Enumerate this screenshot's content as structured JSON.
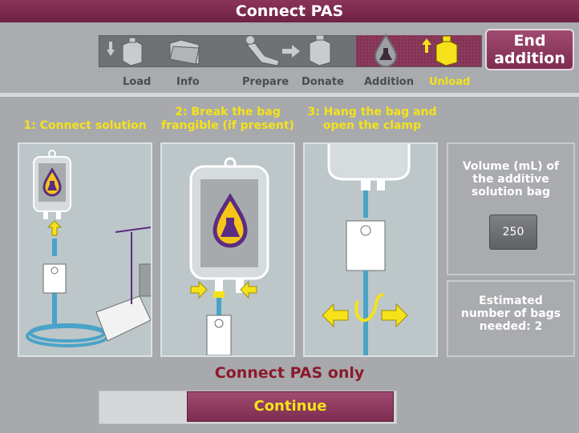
{
  "title": "Connect PAS",
  "steps": [
    {
      "label": "Load",
      "active": false
    },
    {
      "label": "Info",
      "active": false
    },
    {
      "label": "Prepare",
      "active": false
    },
    {
      "label": "Donate",
      "active": false
    },
    {
      "label": "Addition",
      "active": false
    },
    {
      "label": "Unload",
      "active": true
    }
  ],
  "end_button": {
    "line1": "End",
    "line2": "addition"
  },
  "instructions": [
    {
      "line1": "",
      "line2": "1: Connect solution"
    },
    {
      "line1": "2: Break the bag",
      "line2": "frangible (if present)"
    },
    {
      "line1": "3: Hang the bag and",
      "line2": "open the clamp"
    }
  ],
  "volume_panel": {
    "line1": "Volume (mL) of",
    "line2": "the additive",
    "line3": "solution bag",
    "value": "250"
  },
  "estimate_panel": {
    "line1": "Estimated",
    "line2": "number of bags",
    "line3": "needed: 2"
  },
  "status_text": "Connect PAS only",
  "continue_label": "Continue",
  "colors": {
    "title_bar": "#7a2a4c",
    "accent_yellow": "#f5e21a",
    "status_red": "#8b1a2c",
    "tube_blue": "#4aa3c8",
    "drop_purple": "#5a2d82"
  },
  "icons": [
    "load-icon",
    "info-folder-icon",
    "prepare-donor-icon",
    "donate-icon",
    "addition-drop-icon",
    "unload-icon"
  ]
}
